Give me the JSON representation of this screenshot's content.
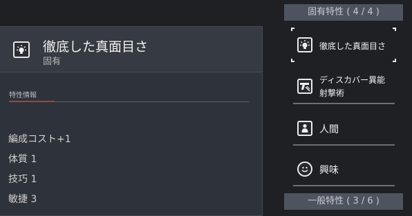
{
  "detail": {
    "trait_name": "徹底した真面目さ",
    "trait_category": "固有",
    "section_label": "特性情報",
    "stats": [
      "編成コスト+1",
      "体質 1",
      "技巧 1",
      "敏捷 3"
    ]
  },
  "intrinsic_group": {
    "header": "固有特性 ( 4 / 4 )",
    "items": [
      {
        "label": "徹底した真面目さ",
        "icon": "lightbulb-icon"
      },
      {
        "label_line1": "ディスカバー異能",
        "label_line2": "射撃術",
        "icon": "gun-icon"
      },
      {
        "label": "人間",
        "icon": "person-icon"
      },
      {
        "label": "興味",
        "icon": "smiley-icon"
      }
    ]
  },
  "general_group": {
    "header": "一般特性 ( 3 / 6 )"
  },
  "colors": {
    "accent_underline": "#a9442f",
    "group_header_bg": "#4d535f"
  }
}
